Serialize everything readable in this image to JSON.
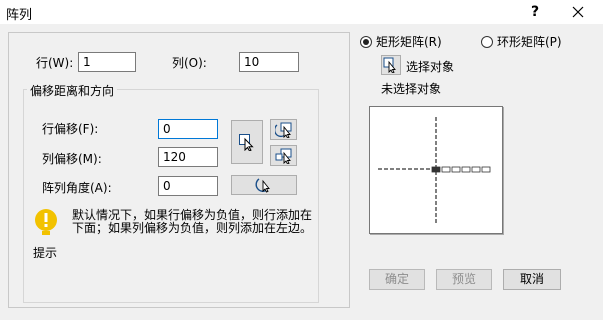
{
  "window": {
    "title": "阵列",
    "help": "?",
    "close": "✕"
  },
  "rows": {
    "label": "行(W):",
    "value": "1"
  },
  "cols": {
    "label": "列(O):",
    "value": "10"
  },
  "offset_group": {
    "title": "偏移距离和方向",
    "row_offset": {
      "label": "行偏移(F):",
      "value": "0"
    },
    "col_offset": {
      "label": "列偏移(M):",
      "value": "120"
    },
    "angle": {
      "label": "阵列角度(A):",
      "value": "0"
    }
  },
  "hint": {
    "text": "默认情况下，如果行偏移为负值，则行添加在下面；如果列偏移为负值，则列添加在左边。",
    "label": "提示",
    "icon": "info-bulb-icon",
    "icon_color": "#f2c200"
  },
  "array_type": {
    "rect": {
      "label": "矩形矩阵(R)",
      "selected": true
    },
    "polar": {
      "label": "环形矩阵(P)",
      "selected": false
    }
  },
  "select_objects": {
    "label": "选择对象",
    "status": "未选择对象"
  },
  "buttons": {
    "ok": "确定",
    "preview": "预览",
    "cancel": "取消"
  },
  "colors": {
    "focus_border": "#0078d7",
    "dialog_bg": "#f0f0f0",
    "disabled_text": "#8d8d8d"
  },
  "preview": {
    "copies": 6
  }
}
